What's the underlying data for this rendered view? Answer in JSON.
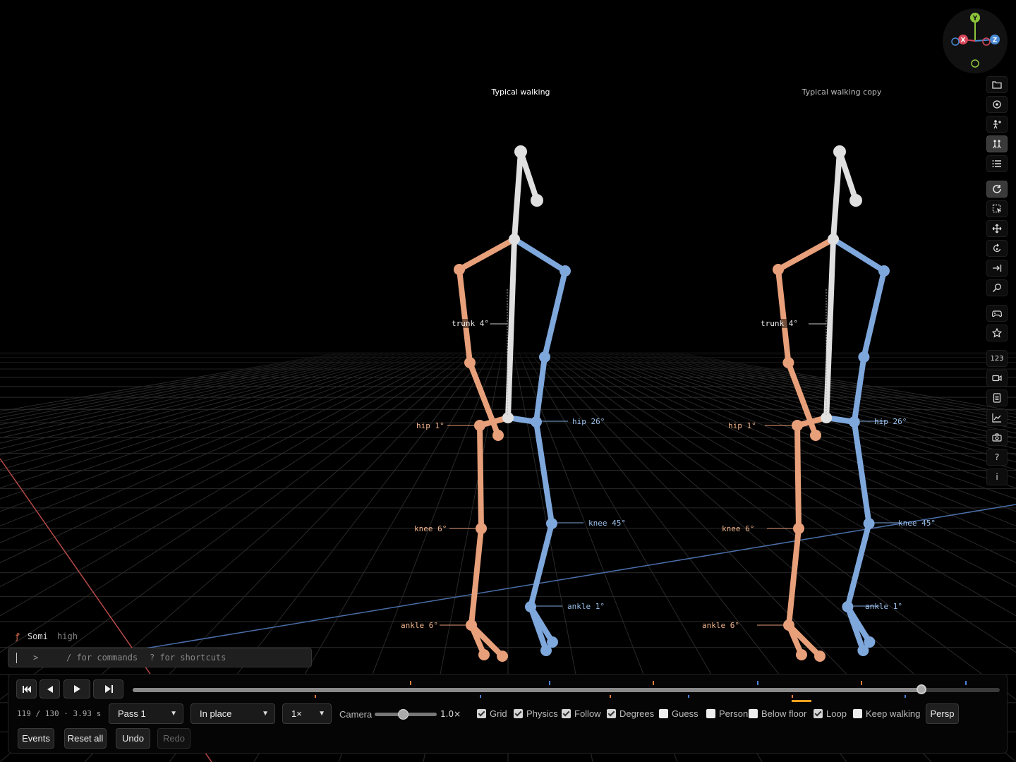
{
  "models": [
    {
      "title": "Typical walking"
    },
    {
      "title": "Typical walking copy"
    }
  ],
  "angles": {
    "trunk": "trunk 4°",
    "left_hip": "hip 1°",
    "left_knee": "knee 6°",
    "left_ankle": "ankle 6°",
    "right_hip": "hip 26°",
    "right_knee": "knee 45°",
    "right_ankle": "ankle 1°"
  },
  "colors": {
    "left_limb": "#e8a07a",
    "right_limb": "#7ea7dc",
    "trunk": "#e0e0e0",
    "event_orange": "#e87a3a",
    "event_blue": "#4a7fd6"
  },
  "gizmo": {
    "x": "X",
    "y": "Y",
    "z": "Z"
  },
  "toolbar": [
    {
      "name": "open-folder-icon",
      "active": false
    },
    {
      "name": "target-icon",
      "active": false
    },
    {
      "name": "add-person-icon",
      "active": false
    },
    {
      "name": "pair-people-icon",
      "active": true
    },
    {
      "name": "list-icon",
      "active": false
    },
    {
      "name": "refresh-icon",
      "active": true
    },
    {
      "name": "select-region-icon",
      "active": false
    },
    {
      "name": "move-icon",
      "active": false
    },
    {
      "name": "rotate-icon",
      "active": false
    },
    {
      "name": "align-right-icon",
      "active": false
    },
    {
      "name": "search-icon",
      "active": false
    },
    {
      "name": "gamepad-icon",
      "active": false
    },
    {
      "name": "star-icon",
      "active": false
    },
    {
      "name": "numbers-icon",
      "label": "123",
      "active": false
    },
    {
      "name": "video-icon",
      "active": false
    },
    {
      "name": "document-icon",
      "active": false
    },
    {
      "name": "chart-icon",
      "active": false
    },
    {
      "name": "camera-icon",
      "active": false
    },
    {
      "name": "help-icon",
      "label": "?",
      "active": false
    },
    {
      "name": "info-icon",
      "label": "i",
      "active": false
    }
  ],
  "user": {
    "name": "Somi",
    "quality": "high"
  },
  "command": {
    "prompt": ">",
    "hint_commands": "/ for commands",
    "hint_shortcuts": "? for shortcuts"
  },
  "playback": {
    "frame": "119 / 130 · 3.93 s",
    "progress": 0.91,
    "events": [
      {
        "pos": 0.32,
        "type": "orange"
      },
      {
        "pos": 0.48,
        "type": "blue"
      },
      {
        "pos": 0.6,
        "type": "orange"
      },
      {
        "pos": 0.72,
        "type": "blue"
      },
      {
        "pos": 0.84,
        "type": "orange"
      },
      {
        "pos": 0.96,
        "type": "blue"
      }
    ],
    "lower_events": [
      {
        "pos": 0.21,
        "type": "orange"
      },
      {
        "pos": 0.4,
        "type": "blue"
      },
      {
        "pos": 0.55,
        "type": "orange"
      },
      {
        "pos": 0.64,
        "type": "blue"
      },
      {
        "pos": 0.76,
        "type": "orange"
      },
      {
        "pos": 0.89,
        "type": "blue"
      }
    ]
  },
  "controls": {
    "pass": "Pass 1",
    "mode": "In place",
    "speed": "1×",
    "camera_label": "Camera",
    "camera_value": "1.0×",
    "camera_zoom": 0.45,
    "persp": "Persp",
    "events": "Events",
    "reset_all": "Reset all",
    "undo": "Undo",
    "redo": "Redo"
  },
  "checkboxes": [
    {
      "name": "grid",
      "label": "Grid",
      "checked": true
    },
    {
      "name": "physics",
      "label": "Physics",
      "checked": true
    },
    {
      "name": "follow",
      "label": "Follow",
      "checked": true
    },
    {
      "name": "degrees",
      "label": "Degrees",
      "checked": true
    },
    {
      "name": "guess",
      "label": "Guess",
      "checked": false
    },
    {
      "name": "person",
      "label": "Person",
      "checked": false
    },
    {
      "name": "below-floor",
      "label": "Below floor",
      "checked": false
    },
    {
      "name": "loop",
      "label": "Loop",
      "checked": true
    },
    {
      "name": "keep-walking",
      "label": "Keep walking",
      "checked": false
    }
  ]
}
